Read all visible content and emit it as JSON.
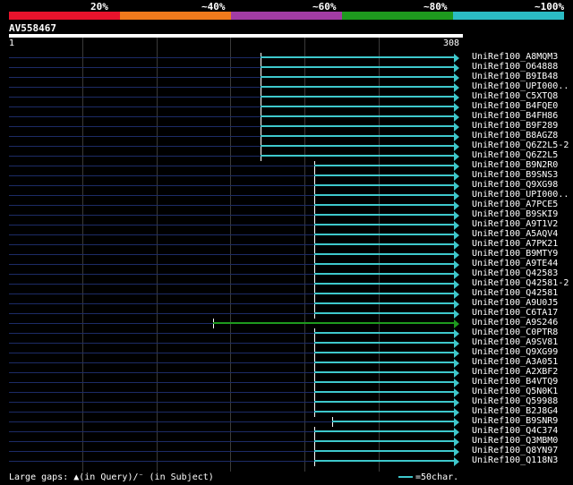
{
  "legend": {
    "labels": [
      "20%",
      "~40%",
      "~60%",
      "~80%",
      "~100%"
    ],
    "colors": [
      "#e8132c",
      "#f07a1c",
      "#a23ca4",
      "#1e9a1e",
      "#2bbcc4"
    ]
  },
  "query": {
    "id": "AV558467",
    "start": "1",
    "end": "308"
  },
  "rows": [
    {
      "label": "UniRef100_A8MQM3",
      "start": 0.56,
      "color": "#3ec8cc"
    },
    {
      "label": "UniRef100_O64888",
      "start": 0.56,
      "color": "#3ec8cc"
    },
    {
      "label": "UniRef100_B9IB48",
      "start": 0.56,
      "color": "#3ec8cc"
    },
    {
      "label": "UniRef100_UPI000..",
      "start": 0.56,
      "color": "#3ec8cc"
    },
    {
      "label": "UniRef100_C5XTQ8",
      "start": 0.56,
      "color": "#3ec8cc"
    },
    {
      "label": "UniRef100_B4FQE0",
      "start": 0.56,
      "color": "#3ec8cc"
    },
    {
      "label": "UniRef100_B4FH86",
      "start": 0.56,
      "color": "#3ec8cc"
    },
    {
      "label": "UniRef100_B9F289",
      "start": 0.56,
      "color": "#3ec8cc"
    },
    {
      "label": "UniRef100_B8AGZ8",
      "start": 0.56,
      "color": "#3ec8cc"
    },
    {
      "label": "UniRef100_Q6Z2L5-2",
      "start": 0.56,
      "color": "#3ec8cc"
    },
    {
      "label": "UniRef100_Q6Z2L5",
      "start": 0.56,
      "color": "#3ec8cc"
    },
    {
      "label": "UniRef100_B9N2R0",
      "start": 0.68,
      "color": "#3ec8cc"
    },
    {
      "label": "UniRef100_B9SNS3",
      "start": 0.68,
      "color": "#3ec8cc"
    },
    {
      "label": "UniRef100_Q9XG98",
      "start": 0.68,
      "color": "#3ec8cc"
    },
    {
      "label": "UniRef100_UPI000..",
      "start": 0.68,
      "color": "#3ec8cc"
    },
    {
      "label": "UniRef100_A7PCE5",
      "start": 0.68,
      "color": "#3ec8cc"
    },
    {
      "label": "UniRef100_B9SKI9",
      "start": 0.68,
      "color": "#3ec8cc"
    },
    {
      "label": "UniRef100_A9T1V2",
      "start": 0.68,
      "color": "#3ec8cc"
    },
    {
      "label": "UniRef100_A5AQV4",
      "start": 0.68,
      "color": "#3ec8cc"
    },
    {
      "label": "UniRef100_A7PK21",
      "start": 0.68,
      "color": "#3ec8cc"
    },
    {
      "label": "UniRef100_B9MTY9",
      "start": 0.68,
      "color": "#3ec8cc"
    },
    {
      "label": "UniRef100_A9TE44",
      "start": 0.68,
      "color": "#3ec8cc"
    },
    {
      "label": "UniRef100_Q42583",
      "start": 0.68,
      "color": "#3ec8cc"
    },
    {
      "label": "UniRef100_Q42581-2",
      "start": 0.68,
      "color": "#3ec8cc"
    },
    {
      "label": "UniRef100_Q42581",
      "start": 0.68,
      "color": "#3ec8cc"
    },
    {
      "label": "UniRef100_A9U0J5",
      "start": 0.68,
      "color": "#3ec8cc"
    },
    {
      "label": "UniRef100_C6TA17",
      "start": 0.68,
      "color": "#3ec8cc"
    },
    {
      "label": "UniRef100_A9S246",
      "start": 0.455,
      "color": "#1e9a1e"
    },
    {
      "label": "UniRef100_C0PTR8",
      "start": 0.68,
      "color": "#3ec8cc"
    },
    {
      "label": "UniRef100_A9SV81",
      "start": 0.68,
      "color": "#3ec8cc"
    },
    {
      "label": "UniRef100_Q9XG99",
      "start": 0.68,
      "color": "#3ec8cc"
    },
    {
      "label": "UniRef100_A3A051",
      "start": 0.68,
      "color": "#3ec8cc"
    },
    {
      "label": "UniRef100_A2XBF2",
      "start": 0.68,
      "color": "#3ec8cc"
    },
    {
      "label": "UniRef100_B4VTQ9",
      "start": 0.68,
      "color": "#3ec8cc"
    },
    {
      "label": "UniRef100_Q5N0K1",
      "start": 0.68,
      "color": "#3ec8cc"
    },
    {
      "label": "UniRef100_Q59988",
      "start": 0.68,
      "color": "#3ec8cc"
    },
    {
      "label": "UniRef100_B2J8G4",
      "start": 0.68,
      "color": "#3ec8cc"
    },
    {
      "label": "UniRef100_B9SNR9",
      "start": 0.72,
      "color": "#3ec8cc"
    },
    {
      "label": "UniRef100_Q4C374",
      "start": 0.68,
      "color": "#3ec8cc"
    },
    {
      "label": "UniRef100_Q3MBM0",
      "start": 0.68,
      "color": "#3ec8cc"
    },
    {
      "label": "UniRef100_Q8YN97",
      "start": 0.68,
      "color": "#3ec8cc"
    },
    {
      "label": "UniRef100_Q118N3",
      "start": 0.68,
      "color": "#3ec8cc"
    }
  ],
  "footer": {
    "gaps_text": "Large gaps: ▲(in Query)/⁻ (in Subject)",
    "scale_text": "=50char."
  }
}
